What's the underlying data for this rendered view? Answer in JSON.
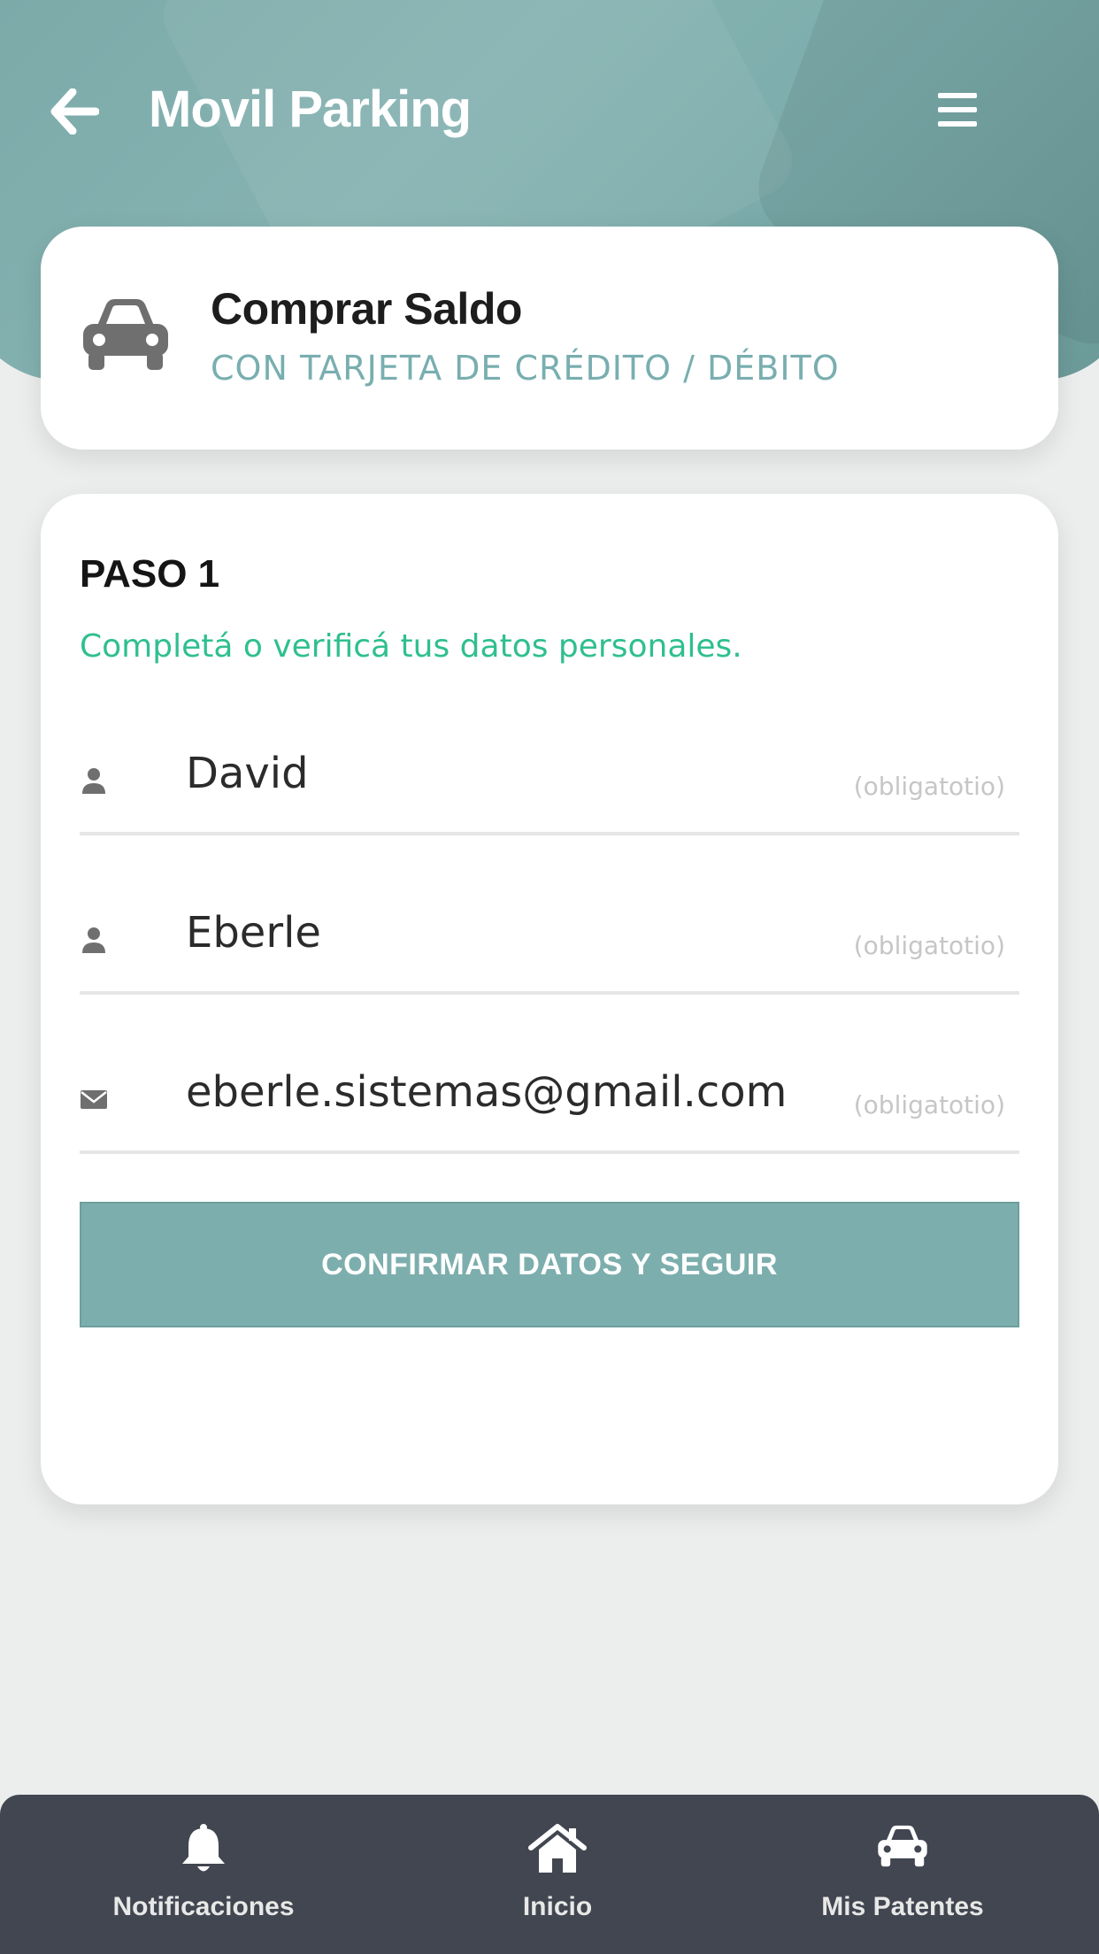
{
  "header": {
    "title": "Movil Parking",
    "icons": {
      "back": "arrow-left-icon",
      "menu": "hamburger-menu-icon"
    }
  },
  "title_card": {
    "icon": "car-icon",
    "title": "Comprar Saldo",
    "subtitle": "CON TARJETA DE CRÉDITO / DÉBITO"
  },
  "form": {
    "step_title": "PASO 1",
    "step_description": "Completá o verificá tus datos personales.",
    "fields": [
      {
        "icon": "user-icon",
        "value": "David",
        "hint": "(obligatotio)"
      },
      {
        "icon": "user-icon",
        "value": "Eberle",
        "hint": "(obligatotio)"
      },
      {
        "icon": "mail-icon",
        "value": "eberle.sistemas@gmail.com",
        "hint": "(obligatotio)"
      }
    ],
    "confirm_label": "CONFIRMAR DATOS Y SEGUIR"
  },
  "bottom_nav": {
    "items": [
      {
        "icon": "bell-icon",
        "label": "Notificaciones"
      },
      {
        "icon": "home-icon",
        "label": "Inicio"
      },
      {
        "icon": "car-icon",
        "label": "Mis Patentes"
      }
    ]
  },
  "colors": {
    "accent": "#7caead",
    "subtitle": "#79aeb0",
    "step_description": "#2fbf90",
    "nav_background": "#414650",
    "page_background": "#eceeed"
  }
}
